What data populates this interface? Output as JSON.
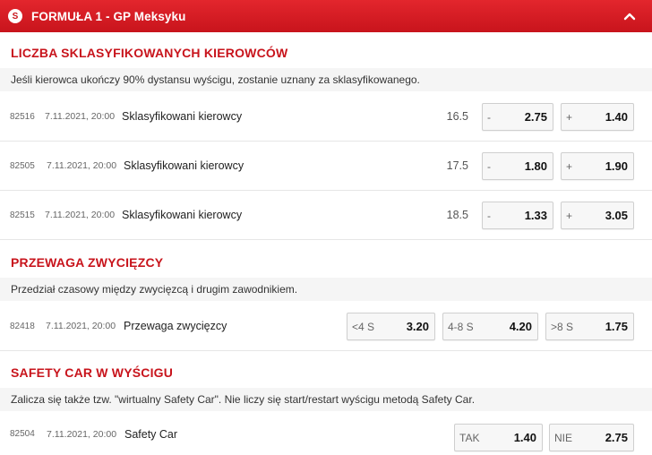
{
  "header": {
    "logo_letter": "S",
    "title": "FORMUŁA 1 - GP Meksyku"
  },
  "sections": [
    {
      "title": "LICZBA SKLASYFIKOWANYCH KIEROWCÓW",
      "description": "Jeśli kierowca ukończy 90% dystansu wyścigu, zostanie uznany za sklasyfikowanego.",
      "rows": [
        {
          "code": "82516",
          "date": "7.11.2021, 20:00",
          "name": "Sklasyfikowani kierowcy",
          "line": "16.5",
          "odds": [
            {
              "label": "-",
              "value": "2.75"
            },
            {
              "label": "+",
              "value": "1.40"
            }
          ]
        },
        {
          "code": "82505",
          "date": "7.11.2021, 20:00",
          "name": "Sklasyfikowani kierowcy",
          "line": "17.5",
          "odds": [
            {
              "label": "-",
              "value": "1.80"
            },
            {
              "label": "+",
              "value": "1.90"
            }
          ]
        },
        {
          "code": "82515",
          "date": "7.11.2021, 20:00",
          "name": "Sklasyfikowani kierowcy",
          "line": "18.5",
          "odds": [
            {
              "label": "-",
              "value": "1.33"
            },
            {
              "label": "+",
              "value": "3.05"
            }
          ]
        }
      ]
    },
    {
      "title": "PRZEWAGA ZWYCIĘZCY",
      "description": "Przedział czasowy między zwycięzcą i drugim zawodnikiem.",
      "rows": [
        {
          "code": "82418",
          "date": "7.11.2021, 20:00",
          "name": "Przewaga zwycięzcy",
          "odds": [
            {
              "label": "<4 S",
              "value": "3.20"
            },
            {
              "label": "4-8 S",
              "value": "4.20"
            },
            {
              "label": ">8 S",
              "value": "1.75"
            }
          ]
        }
      ]
    },
    {
      "title": "SAFETY CAR W WYŚCIGU",
      "description": "Zalicza się także tzw. \"wirtualny Safety Car\". Nie liczy się start/restart wyścigu metodą Safety Car.",
      "rows": [
        {
          "code": "82504",
          "date": "7.11.2021, 20:00",
          "name": "Safety Car",
          "odds": [
            {
              "label": "TAK",
              "value": "1.40"
            },
            {
              "label": "NIE",
              "value": "2.75"
            }
          ]
        }
      ]
    }
  ],
  "colors": {
    "accent": "#c8141c",
    "header_top": "#e3262d"
  }
}
